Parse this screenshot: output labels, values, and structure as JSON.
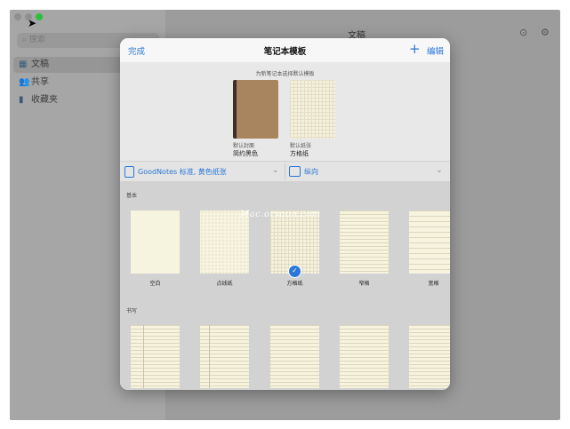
{
  "window": {
    "main_title": "文稿"
  },
  "sidebar": {
    "search_placeholder": "搜索",
    "items": [
      {
        "label": "文稿",
        "icon": "grid-icon"
      },
      {
        "label": "共享",
        "icon": "people-icon"
      },
      {
        "label": "收藏夹",
        "icon": "bookmark-icon"
      }
    ]
  },
  "modal": {
    "done_label": "完成",
    "title": "笔记本模板",
    "edit_label": "编辑",
    "caption": "为新笔记本选择默认模板",
    "cover": {
      "sublabel": "默认封面",
      "label": "简约黑色"
    },
    "paper": {
      "sublabel": "默认纸张",
      "label": "方格纸"
    },
    "template_select": "GoodNotes 标准, 黄色纸张",
    "orientation_select": "纵向",
    "section_basic": "基本",
    "section_writing": "书写",
    "basic_papers": [
      "空白",
      "点线纸",
      "方格纸",
      "窄格",
      "宽格"
    ],
    "selected_paper": "方格纸",
    "watermark": "Mac.orsoon.com",
    "accent_color": "#2b76d6"
  }
}
